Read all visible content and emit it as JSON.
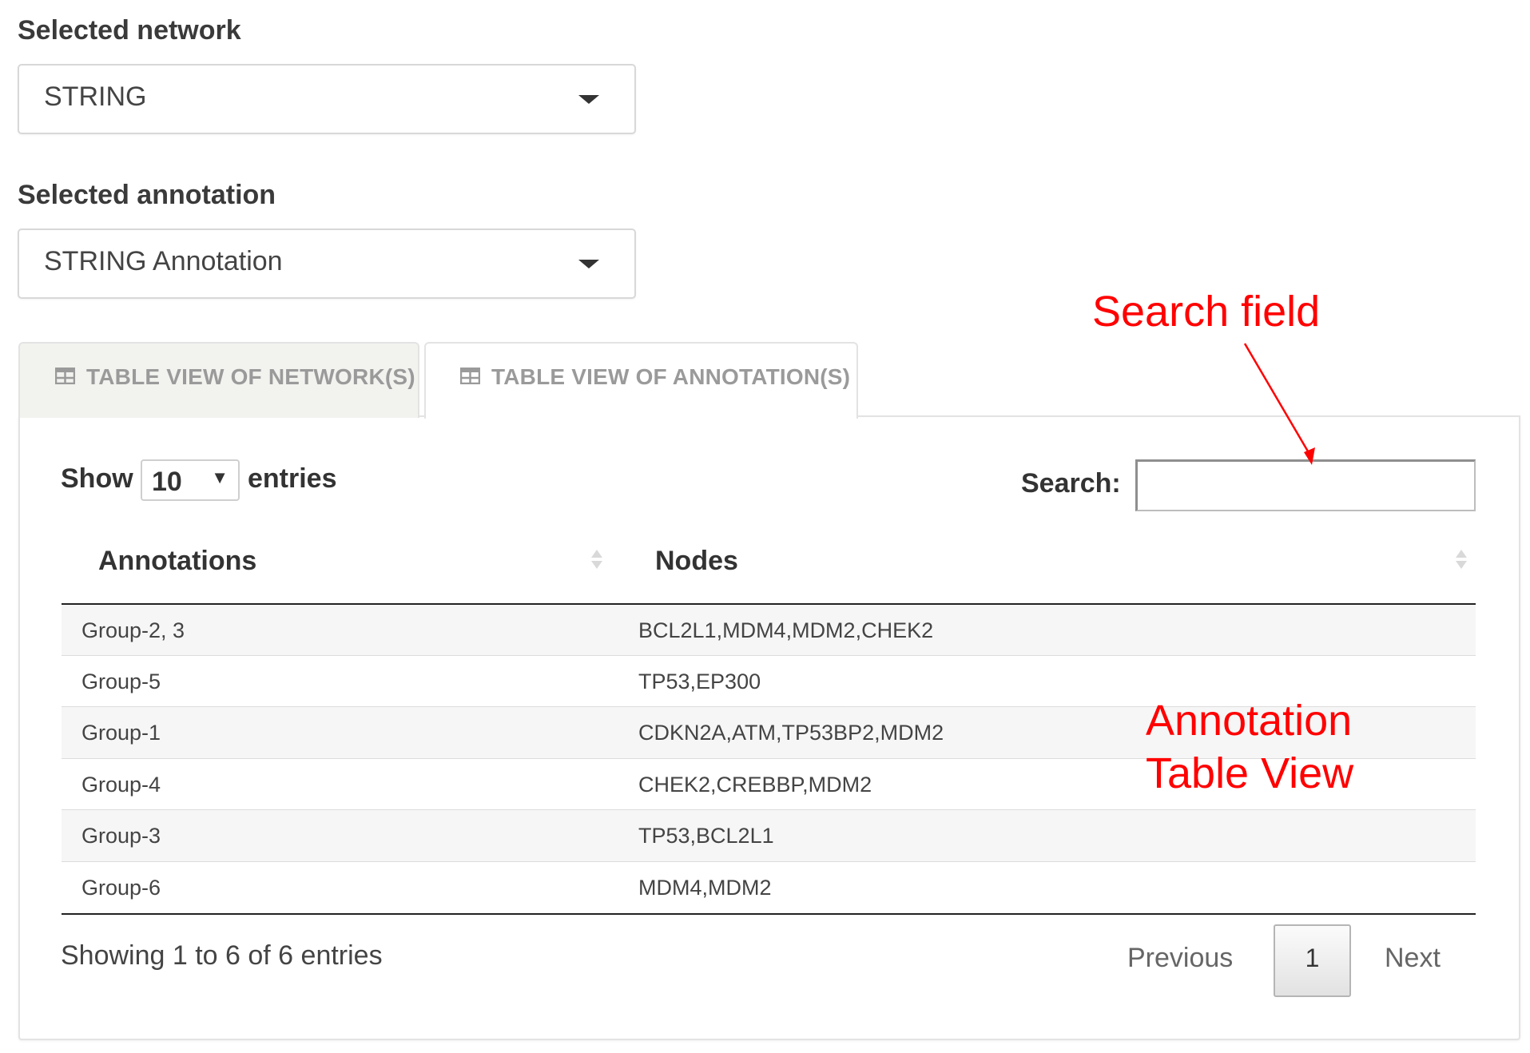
{
  "network": {
    "label": "Selected network",
    "value": "STRING"
  },
  "annotation": {
    "label": "Selected annotation",
    "value": "STRING Annotation"
  },
  "tabs": [
    {
      "label": "TABLE VIEW OF NETWORK(S)",
      "icon": "table-icon",
      "active": false
    },
    {
      "label": "TABLE VIEW OF ANNOTATION(S)",
      "icon": "table-icon",
      "active": true
    }
  ],
  "datatable": {
    "show_label": "Show",
    "length_value": "10",
    "entries_label": "entries",
    "search_label": "Search:",
    "search_value": "",
    "columns": [
      "Annotations",
      "Nodes"
    ],
    "rows": [
      [
        "Group-2, 3",
        "BCL2L1,MDM4,MDM2,CHEK2"
      ],
      [
        "Group-5",
        "TP53,EP300"
      ],
      [
        "Group-1",
        "CDKN2A,ATM,TP53BP2,MDM2"
      ],
      [
        "Group-4",
        "CHEK2,CREBBP,MDM2"
      ],
      [
        "Group-3",
        "TP53,BCL2L1"
      ],
      [
        "Group-6",
        "MDM4,MDM2"
      ]
    ],
    "info": "Showing 1 to 6 of 6 entries",
    "pagination": {
      "previous": "Previous",
      "current_page": "1",
      "next": "Next"
    }
  },
  "annotations_overlay": {
    "search_field": "Search field",
    "table_view_line1": "Annotation",
    "table_view_line2": "Table View",
    "color": "#ff0000"
  }
}
